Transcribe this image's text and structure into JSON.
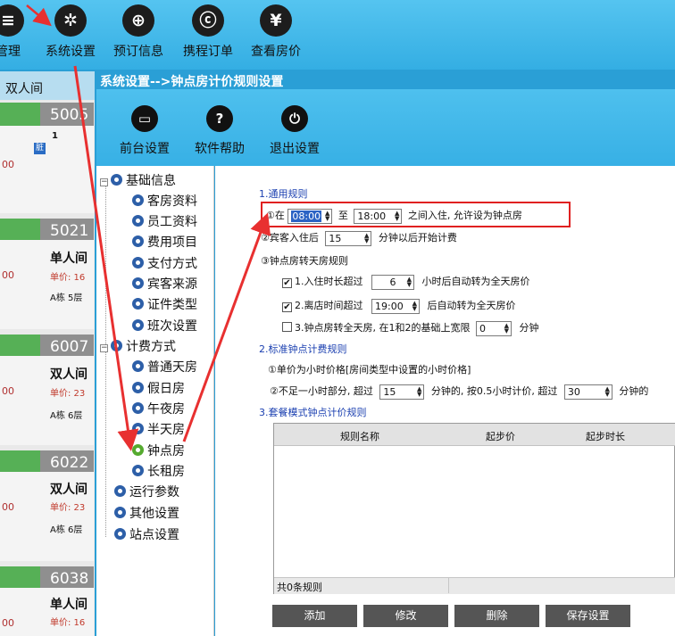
{
  "topbar": {
    "items": [
      {
        "label": "管理",
        "icon": "document-icon"
      },
      {
        "label": "系统设置",
        "icon": "gear-icon"
      },
      {
        "label": "预订信息",
        "icon": "booking-icon"
      },
      {
        "label": "携程订单",
        "icon": "ctrip-icon"
      },
      {
        "label": "查看房价",
        "icon": "yen-icon"
      }
    ]
  },
  "left_panel": {
    "tab_label": "双人间",
    "rooms": [
      {
        "number": "5005",
        "type": "",
        "status_badge": "脏",
        "occupants": "1",
        "amount": "00"
      },
      {
        "number": "5021",
        "type": "单人间",
        "price": "单价: 16",
        "building": "A栋 5层",
        "amount": "00"
      },
      {
        "number": "6007",
        "type": "双人间",
        "price": "单价: 23",
        "building": "A栋 6层",
        "amount": "00"
      },
      {
        "number": "6022",
        "type": "双人间",
        "price": "单价: 23",
        "building": "A栋 6层",
        "amount": "00"
      },
      {
        "number": "6038",
        "type": "单人间",
        "price": "单价: 16",
        "building": "",
        "amount": "00"
      }
    ]
  },
  "dialog": {
    "title": "系统设置-->钟点房计价规则设置",
    "toolbar": [
      {
        "label": "前台设置",
        "icon": "monitor-icon"
      },
      {
        "label": "软件帮助",
        "icon": "help-icon"
      },
      {
        "label": "退出设置",
        "icon": "power-icon"
      }
    ]
  },
  "tree": {
    "groups": [
      {
        "label": "基础信息",
        "expander": "−",
        "children": [
          "客房资料",
          "员工资料",
          "费用项目",
          "支付方式",
          "宾客来源",
          "证件类型",
          "班次设置"
        ]
      },
      {
        "label": "计费方式",
        "expander": "−",
        "children": [
          "普通天房",
          "假日房",
          "午夜房",
          "半天房",
          "钟点房",
          "长租房"
        ]
      },
      {
        "label": "运行参数"
      },
      {
        "label": "其他设置"
      },
      {
        "label": "站点设置"
      }
    ],
    "selected": "钟点房"
  },
  "settings": {
    "section1_title": "1.通用规则",
    "rule1_prefix": "①在",
    "rule1_from": "08:00",
    "rule1_mid": "至",
    "rule1_to": "18:00",
    "rule1_suffix": "之间入住, 允许设为钟点房",
    "rule2_prefix": "②宾客入住后",
    "rule2_value": "15",
    "rule2_suffix": "分钟以后开始计费",
    "rule3_title": "③钟点房转天房规则",
    "rule3_1_label": "1.入住时长超过",
    "rule3_1_value": "6",
    "rule3_1_suffix": "小时后自动转为全天房价",
    "rule3_2_label": "2.离店时间超过",
    "rule3_2_value": "19:00",
    "rule3_2_suffix": "后自动转为全天房价",
    "rule3_3_label": "3.钟点房转全天房, 在1和2的基础上宽限",
    "rule3_3_value": "0",
    "rule3_3_suffix": "分钟",
    "rule3_1_checked": true,
    "rule3_2_checked": true,
    "rule3_3_checked": false,
    "section2_title": "2.标准钟点计费规则",
    "std_rule1": "①单价为小时价格[房间类型中设置的小时价格]",
    "std_rule2_prefix": "②不足一小时部分, 超过",
    "std_rule2_value1": "15",
    "std_rule2_mid": "分钟的, 按0.5小时计价, 超过",
    "std_rule2_value2": "30",
    "std_rule2_suffix": "分钟的",
    "section3_title": "3.套餐模式钟点计价规则"
  },
  "grid": {
    "columns": [
      "规则名称",
      "起步价",
      "起步时长"
    ],
    "rows": [],
    "footer": "共0条规则"
  },
  "buttons": {
    "add": "添加",
    "edit": "修改",
    "delete": "删除",
    "save": "保存设置"
  },
  "colors": {
    "accent": "#2a9fd6",
    "highlight": "#e02020",
    "room_ok": "#56b056",
    "tree_selected": "#55aa2f"
  }
}
